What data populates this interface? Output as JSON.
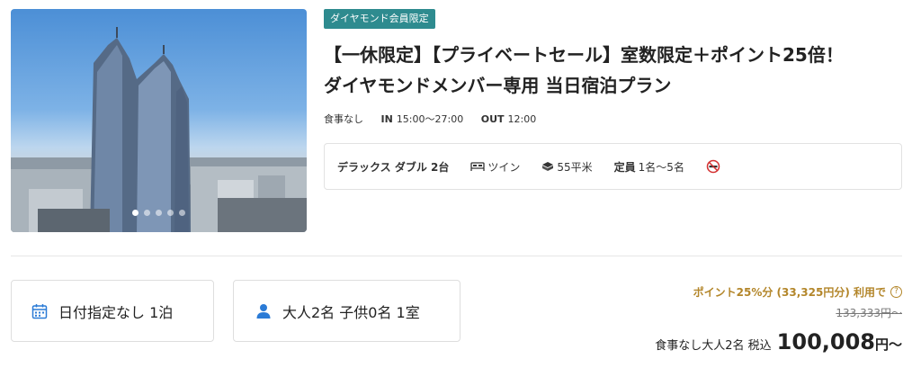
{
  "photo": {
    "alt": "hotel-tower-photo",
    "slide_count": 5,
    "active_slide": 1
  },
  "plan": {
    "badge": "ダイヤモンド会員限定",
    "title_line1": "【一休限定】【プライベートセール】室数限定＋ポイント25倍！",
    "title_line2": "ダイヤモンドメンバー専用 当日宿泊プラン",
    "meal": "食事なし",
    "checkin_label": "IN",
    "checkin_value": "15:00〜27:00",
    "checkout_label": "OUT",
    "checkout_value": "12:00"
  },
  "room": {
    "name": "デラックス ダブル 2台",
    "bed_type": "ツイン",
    "size": "55平米",
    "capacity_label": "定員",
    "capacity_value": "1名〜5名",
    "smoking_icon": "no-smoking-icon"
  },
  "search": {
    "date_text": "日付指定なし 1泊",
    "guest_text": "大人2名 子供0名 1室",
    "date_icon": "calendar-icon",
    "guest_icon": "person-icon"
  },
  "price": {
    "points_text": "ポイント25%分 (33,325円分) 利用で",
    "help_icon": "?",
    "original_price": "133,333円〜",
    "conditions": "食事なし大人2名 税込",
    "amount": "100,008",
    "unit": "円〜"
  },
  "colors": {
    "badge": "#2e8b8f",
    "points": "#b3862a",
    "icon_blue": "#2b7bd6"
  }
}
